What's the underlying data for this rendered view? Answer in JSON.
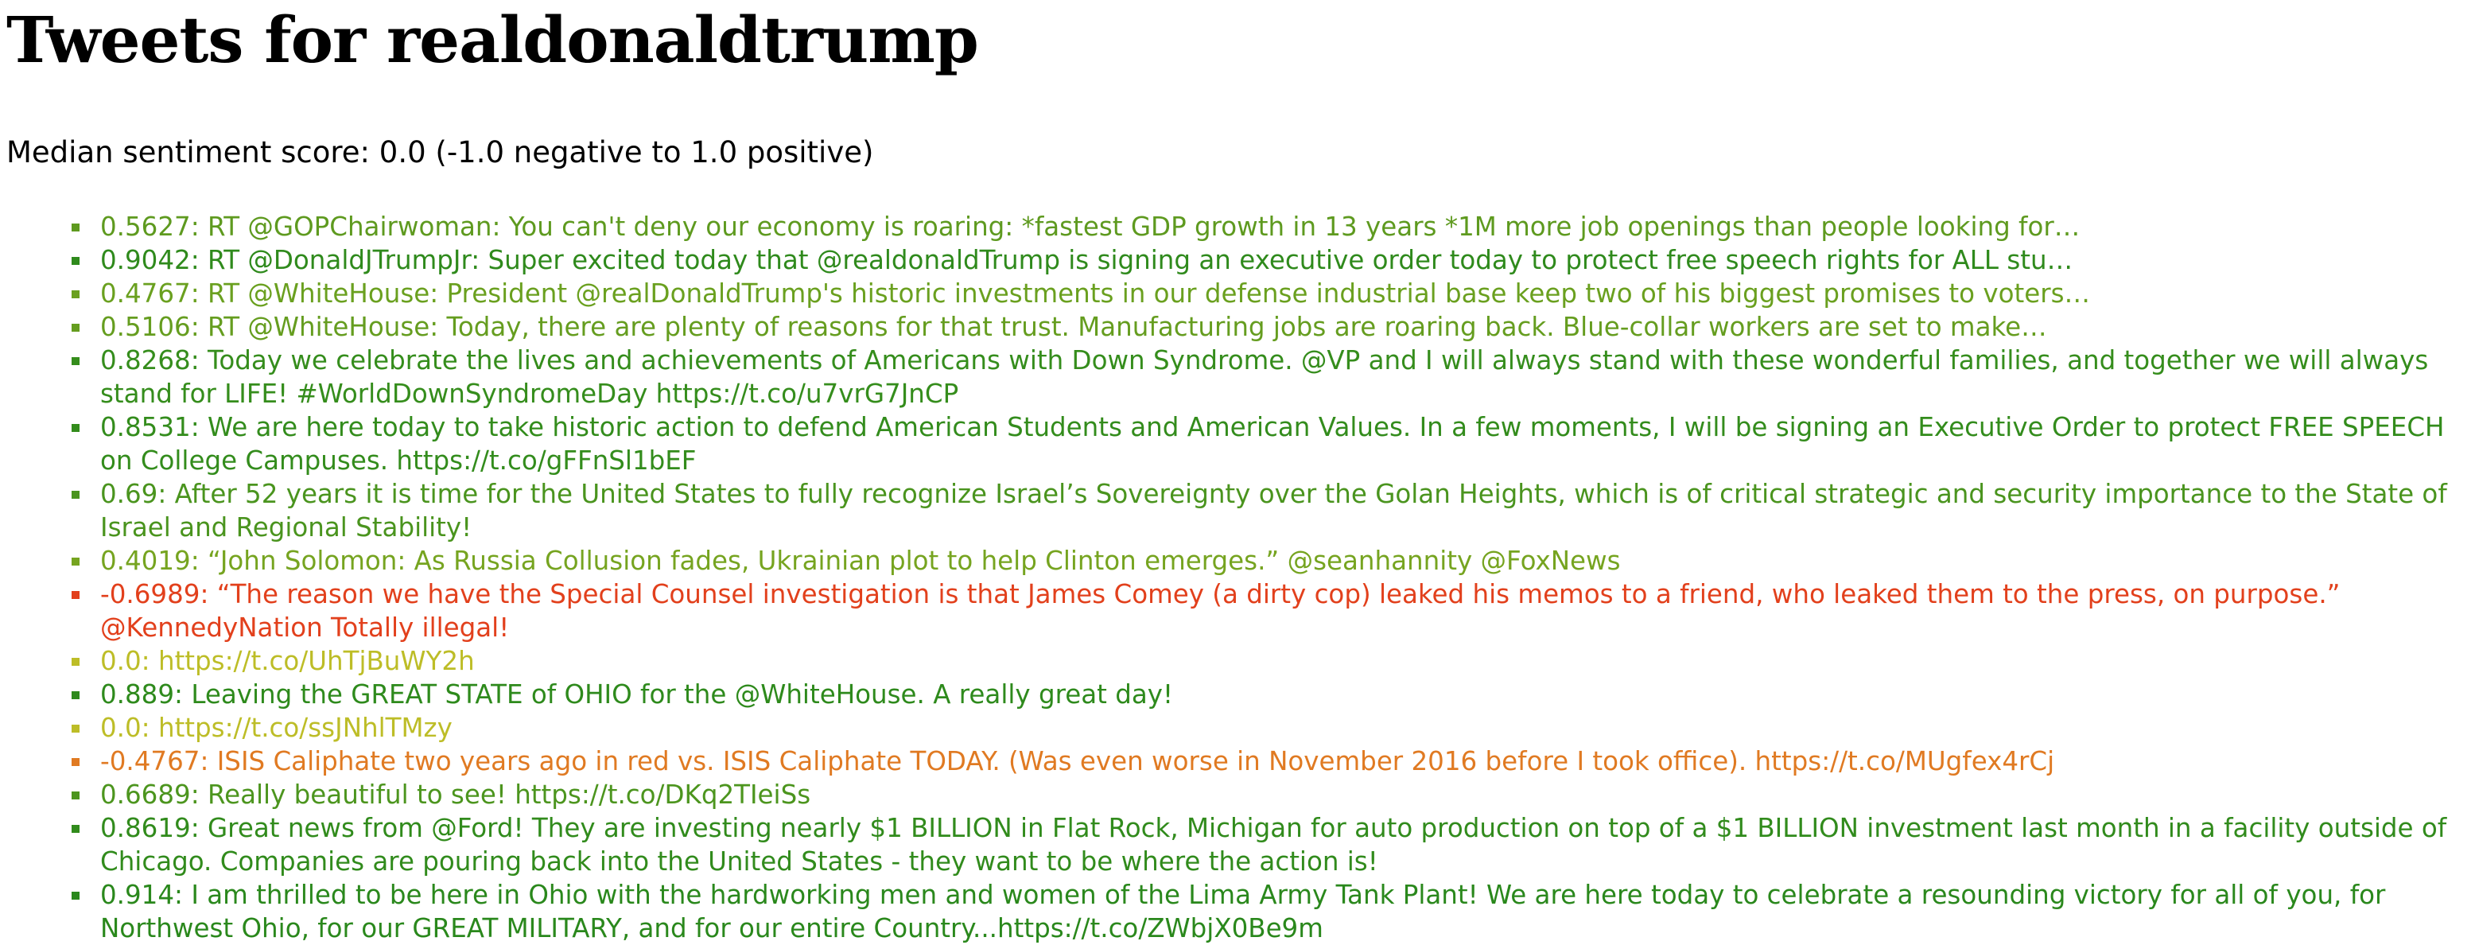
{
  "page": {
    "title": "Tweets for realdonaldtrump",
    "median_text": "Median sentiment score: 0.0 (-1.0 negative to 1.0 positive)"
  },
  "tweets": [
    {
      "text": "0.5627: RT @GOPChairwoman: You can't deny our economy is roaring: *fastest GDP growth in 13 years *1M more job openings than people looking for…",
      "color": "#5e9a1f",
      "truncated": true
    },
    {
      "text": "0.9042: RT @DonaldJTrumpJr: Super excited today that @realdonaldTrump is signing an executive order today to protect free speech rights for ALL stu…",
      "color": "#2f8a1c",
      "truncated": true
    },
    {
      "text": "0.4767: RT @WhiteHouse: President @realDonaldTrump's historic investments in our defense industrial base keep two of his biggest promises to voters…",
      "color": "#6aa01f",
      "truncated": true
    },
    {
      "text": "0.5106: RT @WhiteHouse: Today, there are plenty of reasons for that trust. Manufacturing jobs are roaring back. Blue-collar workers are set to make…",
      "color": "#659d1f",
      "truncated": true
    },
    {
      "text": "0.8268: Today we celebrate the lives and achievements of Americans with Down Syndrome. @VP and I will always stand with these wonderful families, and together we will always stand for LIFE! #WorldDownSyndromeDay https://t.co/u7vrG7JnCP",
      "color": "#358d1c",
      "truncated": false
    },
    {
      "text": "0.8531: We are here today to take historic action to defend American Students and American Values. In a few moments, I will be signing an Executive Order to protect FREE SPEECH on College Campuses. https://t.co/gFFnSl1bEF",
      "color": "#338c1c",
      "truncated": false
    },
    {
      "text": "0.69: After 52 years it is time for the United States to fully recognize Israel’s Sovereignty over the Golan Heights, which is of critical strategic and security importance to the State of Israel and Regional Stability!",
      "color": "#4a941e",
      "truncated": false
    },
    {
      "text": "0.4019: “John Solomon: As Russia Collusion fades, Ukrainian plot to help Clinton emerges.” @seanhannity @FoxNews",
      "color": "#76a420",
      "truncated": false
    },
    {
      "text": "-0.6989: “The reason we have the Special Counsel investigation is that James Comey (a dirty cop) leaked his memos to a friend, who leaked them to the press, on purpose.” @KennedyNation Totally illegal!",
      "color": "#e2401c",
      "truncated": false
    },
    {
      "text": "0.0: https://t.co/UhTjBuWY2h",
      "color": "#bdbd27",
      "truncated": false
    },
    {
      "text": "0.889: Leaving the GREAT STATE of OHIO for the @WhiteHouse. A really great day!",
      "color": "#2e8a1c",
      "truncated": false
    },
    {
      "text": "0.0: https://t.co/ssJNhlTMzy",
      "color": "#bdbd27",
      "truncated": false
    },
    {
      "text": "-0.4767: ISIS Caliphate two years ago in red vs. ISIS Caliphate TODAY. (Was even worse in November 2016 before I took office). https://t.co/MUgfex4rCj",
      "color": "#e07a22",
      "truncated": false
    },
    {
      "text": "0.6689: Really beautiful to see! https://t.co/DKq2TIeiSs",
      "color": "#4c951e",
      "truncated": false
    },
    {
      "text": "0.8619: Great news from @Ford! They are investing nearly $1 BILLION in Flat Rock, Michigan for auto production on top of a $1 BILLION investment last month in a facility outside of Chicago. Companies are pouring back into the United States - they want to be where the action is!",
      "color": "#318b1c",
      "truncated": false
    },
    {
      "text": "0.914: I am thrilled to be here in Ohio with the hardworking men and women of the Lima Army Tank Plant! We are here today to celebrate a resounding victory for all of you, for Northwest Ohio, for our GREAT MILITARY, and for our entire Country...https://t.co/ZWbjX0Be9m",
      "color": "#2a881c",
      "truncated": false
    }
  ]
}
